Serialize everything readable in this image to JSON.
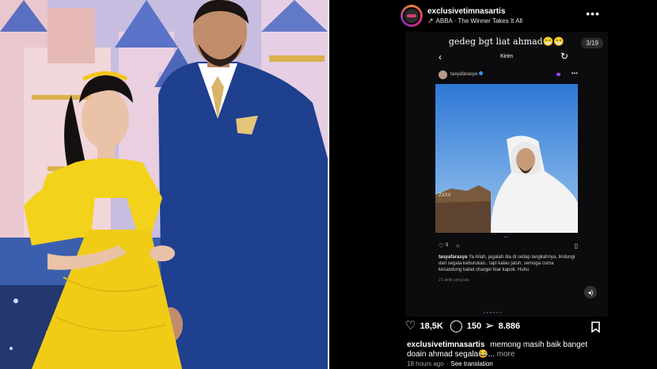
{
  "photo": {
    "description_icons": [
      "castle-backdrop",
      "couple"
    ]
  },
  "ig": {
    "username": "exclusivetimnasartis",
    "music_icon": "arrow-up-right-icon",
    "music": "ABBA · The Winner Takes It All",
    "more_icon": "•••",
    "post": {
      "overlay_text": "gedeg bgt liat ahmad😁😁",
      "counter": "3/19",
      "inner_title": "Kirim",
      "inner_account": "tasyafarasya",
      "inner_likes": "9",
      "inner_caption_user": "tasyafarasya",
      "inner_caption": "Ya Allah, jagalah dia di setiap langkahnya, lindungi dari segala keburukan.. tapi kalau jatuh, semoga cuma kesandung kabel charger biar kapok. Huhu",
      "inner_time": "21 detik yang lalu"
    },
    "likes": "18,5K",
    "comments": "150",
    "shares": "8.886",
    "caption_user": "exclusivetimnasartis",
    "caption_text": "memong masih baik banget doain ahmad segala😂...",
    "caption_more": "more",
    "time": "18 hours ago",
    "see_translation": "See translation",
    "colors": {
      "background": "#000000",
      "accent_blue": "#3897f0",
      "dress_yellow": "#f3d21c",
      "suit_blue": "#1f3f8f"
    }
  }
}
